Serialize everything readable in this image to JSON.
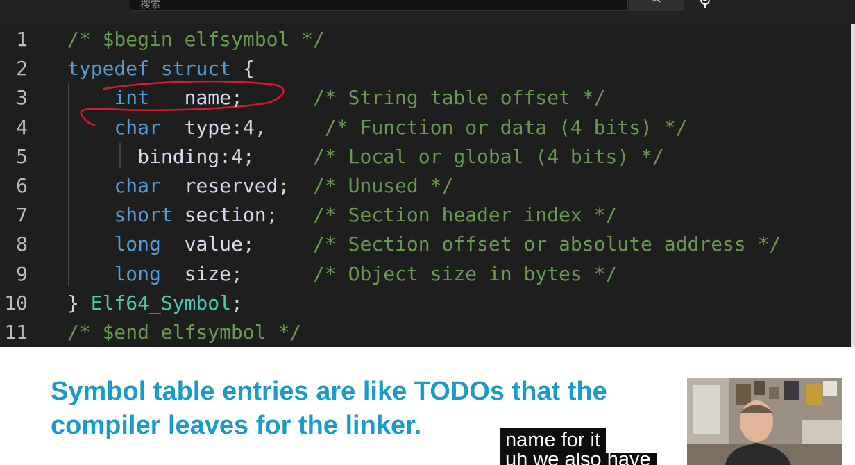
{
  "header": {
    "search_placeholder": "搜索",
    "search_icon": "search-icon",
    "mic_icon": "microphone-icon"
  },
  "code": {
    "lines": [
      {
        "num": "1",
        "tokens": [
          [
            "cm",
            "/* $begin elfsymbol */"
          ]
        ]
      },
      {
        "num": "2",
        "tokens": [
          [
            "kw",
            "typedef"
          ],
          [
            "pu",
            " "
          ],
          [
            "kw",
            "struct"
          ],
          [
            "pu",
            " {"
          ]
        ]
      },
      {
        "num": "3",
        "tokens": [
          [
            "pu",
            "    "
          ],
          [
            "kw",
            "int"
          ],
          [
            "pu",
            "   "
          ],
          [
            "id",
            "name"
          ],
          [
            "pu",
            ";"
          ],
          [
            "pu",
            "      "
          ],
          [
            "cm",
            "/* String table offset */"
          ]
        ]
      },
      {
        "num": "4",
        "tokens": [
          [
            "pu",
            "    "
          ],
          [
            "kw",
            "char"
          ],
          [
            "pu",
            "  "
          ],
          [
            "id",
            "type"
          ],
          [
            "pu",
            ":4,"
          ],
          [
            "pu",
            "     "
          ],
          [
            "cm",
            "/* Function or data (4 bits) */"
          ]
        ]
      },
      {
        "num": "5",
        "tokens": [
          [
            "pu",
            "      "
          ],
          [
            "id",
            "binding"
          ],
          [
            "pu",
            ":4;"
          ],
          [
            "pu",
            "     "
          ],
          [
            "cm",
            "/* Local or global (4 bits) */"
          ]
        ]
      },
      {
        "num": "6",
        "tokens": [
          [
            "pu",
            "    "
          ],
          [
            "kw",
            "char"
          ],
          [
            "pu",
            "  "
          ],
          [
            "id",
            "reserved"
          ],
          [
            "pu",
            ";"
          ],
          [
            "pu",
            "  "
          ],
          [
            "cm",
            "/* Unused */"
          ]
        ]
      },
      {
        "num": "7",
        "tokens": [
          [
            "pu",
            "    "
          ],
          [
            "kw",
            "short"
          ],
          [
            "pu",
            " "
          ],
          [
            "id",
            "section"
          ],
          [
            "pu",
            ";"
          ],
          [
            "pu",
            "   "
          ],
          [
            "cm",
            "/* Section header index */"
          ]
        ]
      },
      {
        "num": "8",
        "tokens": [
          [
            "pu",
            "    "
          ],
          [
            "kw",
            "long"
          ],
          [
            "pu",
            "  "
          ],
          [
            "id",
            "value"
          ],
          [
            "pu",
            ";"
          ],
          [
            "pu",
            "     "
          ],
          [
            "cm",
            "/* Section offset or absolute address */"
          ]
        ]
      },
      {
        "num": "9",
        "tokens": [
          [
            "pu",
            "    "
          ],
          [
            "kw",
            "long"
          ],
          [
            "pu",
            "  "
          ],
          [
            "id",
            "size"
          ],
          [
            "pu",
            ";"
          ],
          [
            "pu",
            "      "
          ],
          [
            "cm",
            "/* Object size in bytes */"
          ]
        ]
      },
      {
        "num": "10",
        "tokens": [
          [
            "pu",
            "} "
          ],
          [
            "ty",
            "Elf64_Symbol"
          ],
          [
            "pu",
            ";"
          ]
        ]
      },
      {
        "num": "11",
        "tokens": [
          [
            "cm",
            "/* $end elfsymbol */"
          ]
        ]
      }
    ]
  },
  "slide": {
    "line1": "Symbol table entries are like TODOs that the",
    "line2": "compiler leaves for the linker."
  },
  "captions": {
    "line1": "name for it",
    "line2": "uh we also have"
  },
  "colors": {
    "keyword": "#569cd6",
    "comment": "#6a9955",
    "identifier": "#d8d8ee",
    "type": "#4ec9b0",
    "annotation_ink": "#e0182a",
    "slide_text": "#1b9bc9"
  }
}
